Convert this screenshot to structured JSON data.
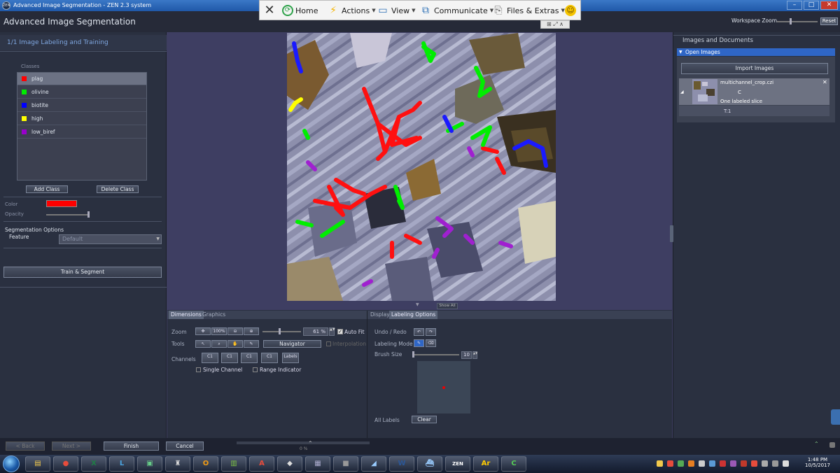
{
  "window": {
    "title": "Advanced Image Segmentation - ZEN 2.3 system",
    "logo": "ZEN",
    "minimize": "–",
    "maximize": "□",
    "close": "✕"
  },
  "app": {
    "title": "Advanced Image Segmentation"
  },
  "workspace": {
    "zoom_label": "Workspace Zoom",
    "reset_label": "Reset"
  },
  "quick_toolbar": {
    "close_icon": "close-icon",
    "items": [
      {
        "label": "Home",
        "icon": "home-icon"
      },
      {
        "label": "Actions",
        "icon": "lightning-icon"
      },
      {
        "label": "View",
        "icon": "monitor-icon"
      },
      {
        "label": "Communicate",
        "icon": "network-icon"
      },
      {
        "label": "Files & Extras",
        "icon": "files-icon"
      }
    ],
    "emoji_icon": "smiley-icon"
  },
  "step": {
    "label": "1/1  Image Labeling and Training"
  },
  "classes": {
    "header": "Classes",
    "items": [
      {
        "name": "plag",
        "color": "#ff0000",
        "selected": true
      },
      {
        "name": "olivine",
        "color": "#00ee00",
        "selected": false
      },
      {
        "name": "biotite",
        "color": "#0000ff",
        "selected": false
      },
      {
        "name": "high",
        "color": "#ffff00",
        "selected": false
      },
      {
        "name": "low_biref",
        "color": "#9900cc",
        "selected": false
      }
    ],
    "add_label": "Add Class",
    "delete_label": "Delete Class",
    "color_label": "Color",
    "opacity_label": "Opacity"
  },
  "segmentation": {
    "options_label": "Segmentation Options",
    "feature_label": "Feature",
    "feature_value": "Default",
    "train_label": "Train & Segment"
  },
  "show_all_label": "Show All",
  "dimensions": {
    "tab_dimensions": "Dimensions",
    "tab_graphics": "Graphics",
    "zoom_label": "Zoom",
    "zoom_value": "61 %",
    "zoom_fit_label": "100%",
    "auto_fit_label": "Auto Fit",
    "auto_fit_checked": true,
    "tools_label": "Tools",
    "navigator_label": "Navigator",
    "interpolation_label": "Interpolation",
    "channels_label": "Channels",
    "channel_names": [
      "C1",
      "C1",
      "C1",
      "C1"
    ],
    "labels_channel": "Labels",
    "single_channel_label": "Single Channel",
    "range_indicator_label": "Range Indicator"
  },
  "labeling": {
    "tab_display": "Display",
    "tab_labeling": "Labeling Options",
    "undo_redo_label": "Undo / Redo",
    "mode_label": "Labeling Mode",
    "brush_size_label": "Brush Size",
    "brush_size_value": "10",
    "all_labels_label": "All Labels",
    "clear_label": "Clear"
  },
  "images_docs": {
    "title": "Images and Documents",
    "open_images_label": "Open Images",
    "import_label": "Import Images",
    "file_name": "multichannel_crop.czi",
    "channel": "C",
    "description": "One labeled slice",
    "time": "T:1"
  },
  "nav": {
    "back_label": "< Back",
    "next_label": "Next >",
    "finish_label": "Finish",
    "cancel_label": "Cancel",
    "progress_text": "0 %"
  },
  "taskbar": {
    "time": "1:48 PM",
    "date": "10/5/2017",
    "apps": [
      {
        "name": "explorer",
        "glyph": "▤",
        "color": "#f2c94c"
      },
      {
        "name": "chrome",
        "glyph": "●",
        "color": "#e74c3c"
      },
      {
        "name": "excel",
        "glyph": "X",
        "color": "#1e7d45"
      },
      {
        "name": "app-l",
        "glyph": "L",
        "color": "#4aa3df"
      },
      {
        "name": "terminal",
        "glyph": "▣",
        "color": "#6c8"
      },
      {
        "name": "joystick",
        "glyph": "♜",
        "color": "#ddd"
      },
      {
        "name": "outlook",
        "glyph": "O",
        "color": "#f39c12"
      },
      {
        "name": "chart-app",
        "glyph": "▥",
        "color": "#7bc043"
      },
      {
        "name": "acrobat",
        "glyph": "A",
        "color": "#e74c3c"
      },
      {
        "name": "inkscape",
        "glyph": "◆",
        "color": "#ddd"
      },
      {
        "name": "notepad",
        "glyph": "▦",
        "color": "#aac"
      },
      {
        "name": "console",
        "glyph": "■",
        "color": "#999"
      },
      {
        "name": "files",
        "glyph": "◢",
        "color": "#9cf"
      },
      {
        "name": "word",
        "glyph": "W",
        "color": "#2b5797"
      },
      {
        "name": "ship",
        "glyph": "⛴",
        "color": "#9cf"
      },
      {
        "name": "zen",
        "glyph": "ZEN",
        "color": "#fff"
      },
      {
        "name": "aurora",
        "glyph": "Ar",
        "color": "#fc0"
      },
      {
        "name": "camtasia",
        "glyph": "C",
        "color": "#5c5"
      }
    ],
    "tray": [
      "#f2c94c",
      "#e74c3c",
      "#5a5",
      "#e67e22",
      "#ccc",
      "#5a9ad6",
      "#c33",
      "#9b59b6",
      "#c0392b",
      "#e74c3c",
      "#aaa",
      "#999",
      "#ddd"
    ]
  }
}
